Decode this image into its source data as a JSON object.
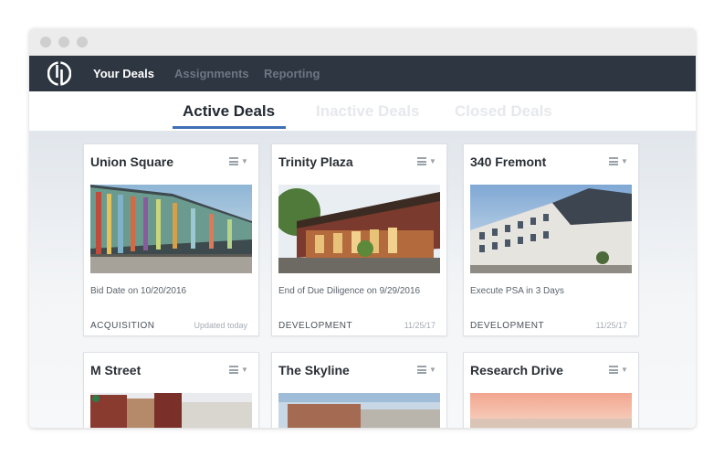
{
  "nav": {
    "items": [
      {
        "label": "Your Deals",
        "active": true
      },
      {
        "label": "Assignments",
        "active": false
      },
      {
        "label": "Reporting",
        "active": false
      }
    ]
  },
  "tabs": [
    {
      "label": "Active Deals",
      "active": true
    },
    {
      "label": "Inactive Deals",
      "active": false
    },
    {
      "label": "Closed Deals",
      "active": false
    }
  ],
  "deals": [
    {
      "title": "Union Square",
      "status": "Bid Date on 10/20/2016",
      "type": "ACQUISITION",
      "updated": "Updated today"
    },
    {
      "title": "Trinity Plaza",
      "status": "End of Due Diligence on 9/29/2016",
      "type": "DEVELOPMENT",
      "updated": "11/25/17"
    },
    {
      "title": "340 Fremont",
      "status": "Execute PSA in 3 Days",
      "type": "DEVELOPMENT",
      "updated": "11/25/17"
    },
    {
      "title": "M Street"
    },
    {
      "title": "The Skyline"
    },
    {
      "title": "Research Drive"
    }
  ],
  "icons": {
    "logo": "dp-logo-icon",
    "menu": "list-menu-icon"
  },
  "colors": {
    "nav_bg": "#2d3641",
    "accent": "#3f6fb5"
  }
}
